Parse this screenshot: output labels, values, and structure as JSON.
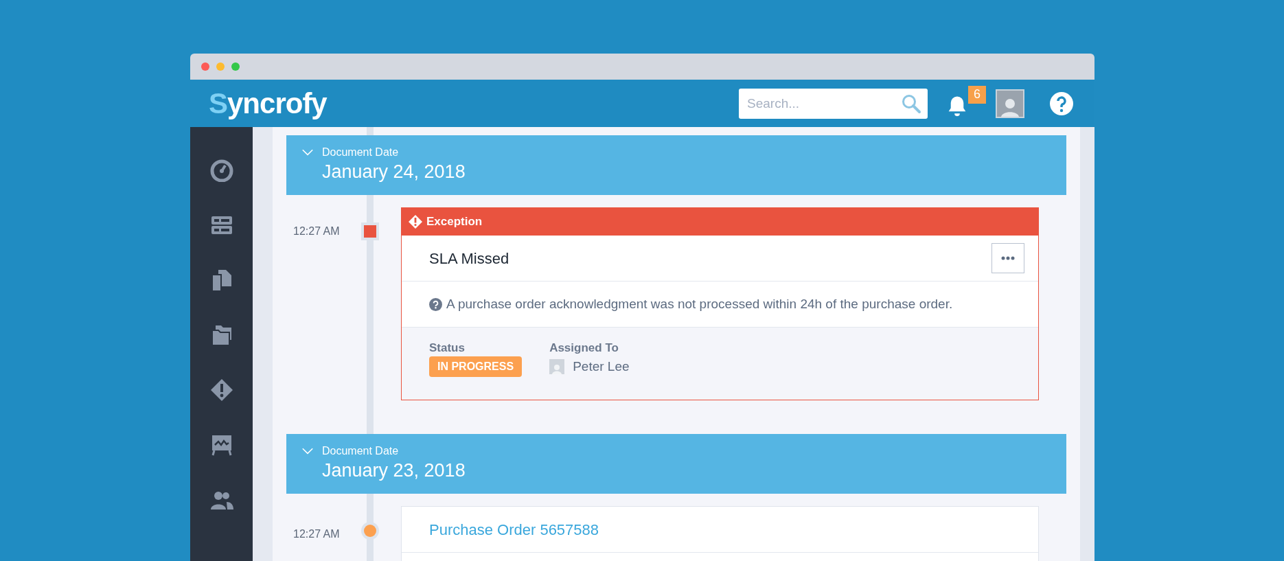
{
  "header": {
    "logo": "Syncrofy",
    "search": {
      "placeholder": "Search..."
    },
    "notifications": {
      "count": "6"
    }
  },
  "sidebar": {
    "items": [
      {
        "kind": "dashboard"
      },
      {
        "kind": "list"
      },
      {
        "kind": "documents"
      },
      {
        "kind": "folders"
      },
      {
        "kind": "exceptions"
      },
      {
        "kind": "reports"
      },
      {
        "kind": "users"
      }
    ]
  },
  "timeline": [
    {
      "label": "Document Date",
      "date": "January 24, 2018",
      "expanded": true,
      "events": [
        {
          "kind": "exception",
          "time": "12:27 AM",
          "header": "Exception",
          "title": "SLA Missed",
          "description": "A purchase order acknowledgment was not processed within 24h of the purchase order.",
          "status_label": "Status",
          "status": "IN PROGRESS",
          "assigned_label": "Assigned To",
          "assignee": "Peter Lee"
        }
      ]
    },
    {
      "label": "Document Date",
      "date": "January 23, 2018",
      "expanded": true,
      "events": [
        {
          "kind": "document",
          "time": "12:27 AM",
          "title": "Purchase Order 5657588"
        }
      ]
    }
  ]
}
